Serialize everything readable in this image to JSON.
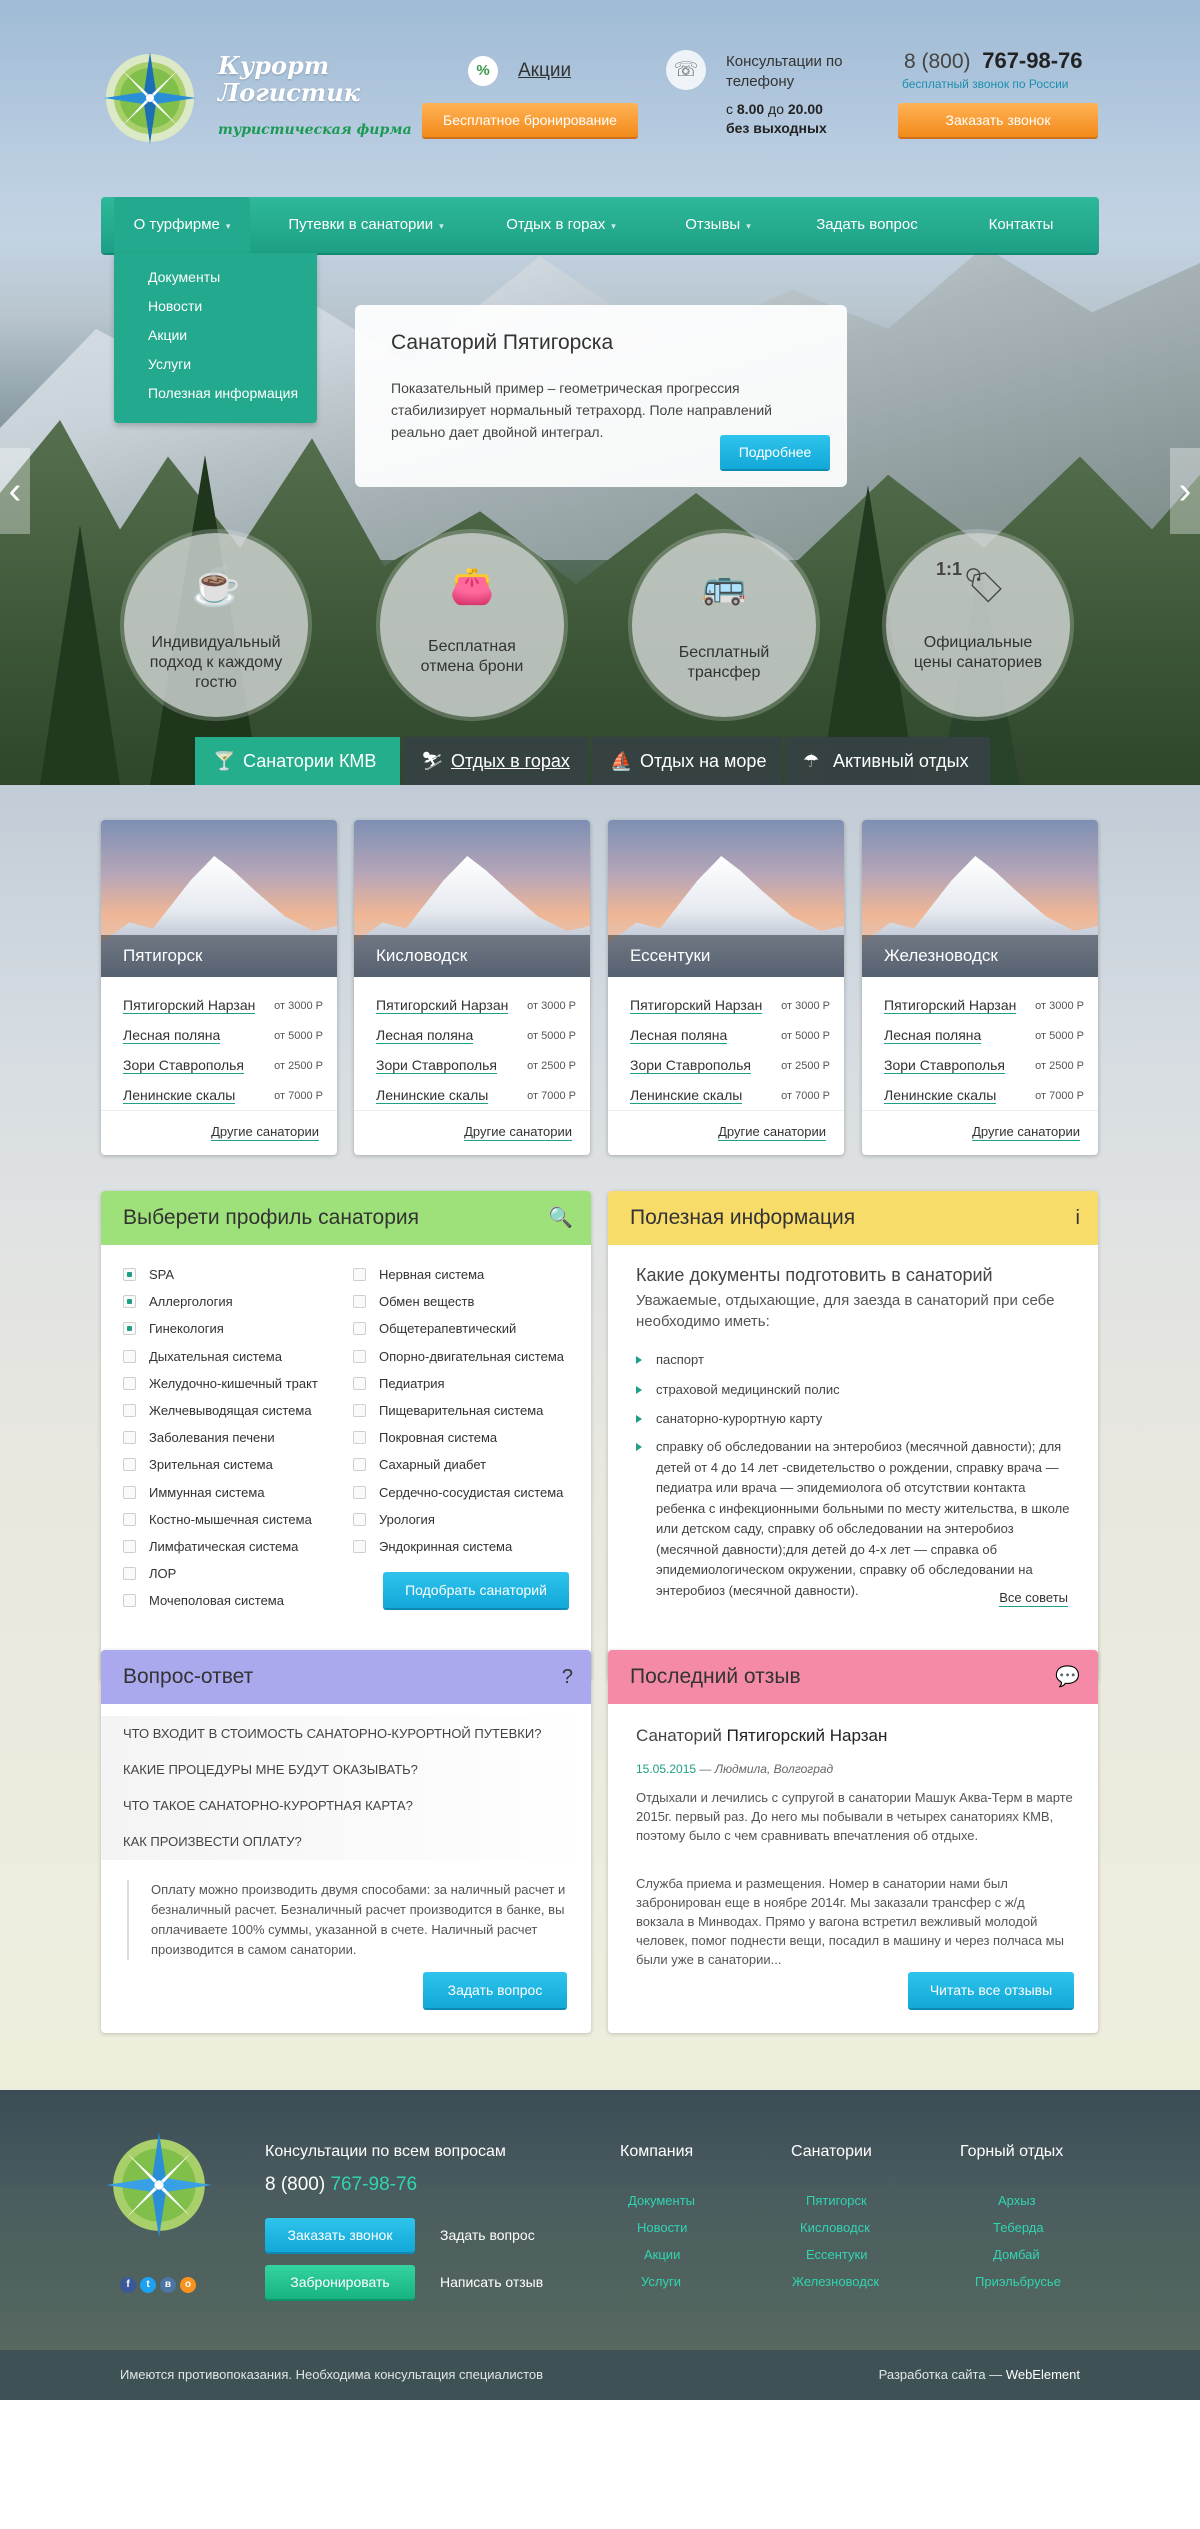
{
  "header": {
    "brand_line1": "Курорт",
    "brand_line2": "Логистик",
    "brand_tagline": "туристическая фирма",
    "promo_link": "Акции",
    "promo_icon": "percent-icon",
    "free_booking_btn": "Бесплатное бронирование",
    "consult_text": "Консультации по телефону",
    "hours_prefix": "с",
    "hours_from": "8.00",
    "hours_mid": "до",
    "hours_to": "20.00",
    "hours_days": "без выходных",
    "phone_code": "8 (800)",
    "phone_number": "767-98-76",
    "free_call": "бесплатный звонок по России",
    "callback_btn": "Заказать звонок"
  },
  "nav": {
    "items": [
      {
        "label": "О турфирме"
      },
      {
        "label": "Путевки в санатории"
      },
      {
        "label": "Отдых в горах"
      },
      {
        "label": "Отзывы"
      },
      {
        "label": "Задать вопрос"
      },
      {
        "label": "Контакты"
      }
    ],
    "dropdown": [
      "Документы",
      "Новости",
      "Акции",
      "Услуги",
      "Полезная информация"
    ]
  },
  "slide": {
    "title": "Санаторий Пятигорска",
    "text": "Показательный пример – геометрическая прогрессия стабилизирует нормальный тетрахорд. Поле направлений реально дает двойной интеграл.",
    "button": "Подробнее",
    "prev": "‹",
    "next": "›"
  },
  "features": [
    {
      "text": "Индивидуальный подход к каждому гостю",
      "icon": "cup-icon"
    },
    {
      "text": "Бесплатная отмена брони",
      "icon": "wallet-icon"
    },
    {
      "text": "Бесплатный трансфер",
      "icon": "bus-icon"
    },
    {
      "text": "Официальные цены санаториев",
      "icon": "price-tag-icon",
      "badge": "1:1"
    }
  ],
  "tabs": [
    {
      "label": "Санатории КМВ",
      "icon": "cocktail-icon"
    },
    {
      "label": "Отдых в горах",
      "icon": "ski-icon"
    },
    {
      "label": "Отдых на море",
      "icon": "ship-icon"
    },
    {
      "label": "Активный отдых",
      "icon": "parachute-icon"
    }
  ],
  "cities": [
    {
      "name": "Пятигорск",
      "more": "Другие санатории",
      "rows": [
        {
          "n": "Пятигорский Нарзан",
          "p": "от 3000 Р"
        },
        {
          "n": "Лесная поляна",
          "p": "от 5000 Р"
        },
        {
          "n": "Зори Ставрополья",
          "p": "от 2500 Р"
        },
        {
          "n": "Ленинские скалы",
          "p": "от 7000 Р"
        }
      ]
    },
    {
      "name": "Кисловодск",
      "more": "Другие санатории",
      "rows": [
        {
          "n": "Пятигорский Нарзан",
          "p": "от 3000 Р"
        },
        {
          "n": "Лесная поляна",
          "p": "от 5000 Р"
        },
        {
          "n": "Зори Ставрополья",
          "p": "от 2500 Р"
        },
        {
          "n": "Ленинские скалы",
          "p": "от 7000 Р"
        }
      ]
    },
    {
      "name": "Ессентуки",
      "more": "Другие санатории",
      "rows": [
        {
          "n": "Пятигорский Нарзан",
          "p": "от 3000 Р"
        },
        {
          "n": "Лесная поляна",
          "p": "от 5000 Р"
        },
        {
          "n": "Зори Ставрополья",
          "p": "от 2500 Р"
        },
        {
          "n": "Ленинские скалы",
          "p": "от 7000 Р"
        }
      ]
    },
    {
      "name": "Железноводск",
      "more": "Другие санатории",
      "rows": [
        {
          "n": "Пятигорский Нарзан",
          "p": "от 3000 Р"
        },
        {
          "n": "Лесная поляна",
          "p": "от 5000 Р"
        },
        {
          "n": "Зори Ставрополья",
          "p": "от 2500 Р"
        },
        {
          "n": "Ленинские скалы",
          "p": "от 7000 Р"
        }
      ]
    }
  ],
  "profile": {
    "title": "Выберети профиль санатория",
    "icon": "search-icon",
    "col1": [
      {
        "label": "SPA",
        "checked": true
      },
      {
        "label": "Аллергология",
        "checked": true
      },
      {
        "label": "Гинекология",
        "checked": true
      },
      {
        "label": "Дыхательная система",
        "checked": false
      },
      {
        "label": "Желудочно-кишечный тракт",
        "checked": false
      },
      {
        "label": "Желчевыводящая система",
        "checked": false
      },
      {
        "label": "Заболевания печени",
        "checked": false
      },
      {
        "label": "Зрительная система",
        "checked": false
      },
      {
        "label": "Иммунная система",
        "checked": false
      },
      {
        "label": "Костно-мышечная система",
        "checked": false
      },
      {
        "label": "Лимфатическая система",
        "checked": false
      },
      {
        "label": "ЛОР",
        "checked": false
      },
      {
        "label": "Мочеполовая система",
        "checked": false
      }
    ],
    "col2": [
      {
        "label": "Нервная система",
        "checked": false
      },
      {
        "label": "Обмен веществ",
        "checked": false
      },
      {
        "label": "Общетерапевтический",
        "checked": false
      },
      {
        "label": "Опорно-двигательная система",
        "checked": false
      },
      {
        "label": "Педиатрия",
        "checked": false
      },
      {
        "label": "Пищеварительная система",
        "checked": false
      },
      {
        "label": "Покровная система",
        "checked": false
      },
      {
        "label": "Сахарный диабет",
        "checked": false
      },
      {
        "label": "Сердечно-сосудистая система",
        "checked": false
      },
      {
        "label": "Урология",
        "checked": false
      },
      {
        "label": "Эндокринная система",
        "checked": false
      }
    ],
    "button": "Подобрать санаторий"
  },
  "info": {
    "title": "Полезная информация",
    "icon_glyph": "i",
    "q_title": "Какие документы подготовить в санаторий",
    "intro": "Уважаемые, отдыхающие, для заезда в санаторий при себе необходимо иметь:",
    "bullets": [
      "паспорт",
      "страховой медицинский полис",
      "санаторно-курортную карту",
      "справку об обследовании на энтеробиоз (месячной давности); для детей от 4 до 14 лет -свидетельство о рождении, справку врача — педиатра или врача — эпидемиолога об отсутствии контакта ребенка с инфекционными больными по месту жительства, в школе или детском саду, справку об обследовании на энтеробиоз (месячной давности);для детей до 4-х лет — справка об эпидемиологическом окружении, справку об обследовании на энтеробиоз (месячной давности)."
    ],
    "more": "Все советы"
  },
  "faq": {
    "title": "Вопрос-ответ",
    "icon_glyph": "?",
    "questions": [
      "ЧТО ВХОДИТ В СТОИМОСТЬ САНАТОРНО-КУРОРТНОЙ ПУТЕВКИ?",
      "КАКИЕ ПРОЦЕДУРЫ МНЕ БУДУТ ОКАЗЫВАТЬ?",
      "ЧТО ТАКОЕ САНАТОРНО-КУРОРТНАЯ КАРТА?",
      "КАК ПРОИЗВЕСТИ ОПЛАТУ?"
    ],
    "answer": "Оплату можно производить двумя способами: за наличный расчет и безналичный расчет. Безналичный расчет производится в банке, вы оплачиваете 100% суммы, указанной в счете. Наличный расчет производится в самом санатории.",
    "button": "Задать вопрос"
  },
  "review": {
    "title": "Последний отзыв",
    "icon": "chat-icon",
    "sanatorium_prefix": "Санаторий",
    "sanatorium_name": "Пятигорский Нарзан",
    "date": "15.05.2015",
    "author": "— Людмила, Волгоград",
    "p1": "Отдыхали и лечились с супругой в санатории Машук Аква-Терм в марте 2015г. первый раз. До него мы побывали в четырех санаториях КМВ, поэтому было с чем сравнивать впечатления об отдыхе.",
    "p2": "Служба приема и размещения. Номер в санатории нами был забронирован еще в ноябре 2014г. Мы заказали трансфер с ж/д вокзала в Минводах. Прямо у вагона встретил вежливый молодой человек, помог поднести вещи, посадил в машину и через полчаса мы были уже в санатории...",
    "button": "Читать все отзывы"
  },
  "footer": {
    "consult_title": "Консультации по всем вопросам",
    "phone_code": "8 (800)",
    "phone_number": "767-98-76",
    "callback_btn": "Заказать звонок",
    "ask_link": "Задать вопрос",
    "book_btn": "Забронировать",
    "review_link": "Написать отзыв",
    "social": [
      {
        "glyph": "f",
        "color": "#3b5998",
        "icon": "facebook-icon"
      },
      {
        "glyph": "t",
        "color": "#1da1f2",
        "icon": "twitter-icon"
      },
      {
        "glyph": "в",
        "color": "#4c75a3",
        "icon": "vk-icon"
      },
      {
        "glyph": "о",
        "color": "#f7931e",
        "icon": "odnoklassniki-icon"
      }
    ],
    "cols": [
      {
        "title": "Компания",
        "links": [
          "Документы",
          "Новости",
          "Акции",
          "Услуги"
        ]
      },
      {
        "title": "Санатории",
        "links": [
          "Пятигорск",
          "Кисловодск",
          "Ессентуки",
          "Железноводск"
        ]
      },
      {
        "title": "Горный отдых",
        "links": [
          "Архыз",
          "Теберда",
          "Домбай",
          "Приэльбрусье"
        ]
      }
    ],
    "disclaimer": "Имеются противопоказания. Необходима консультация специалистов",
    "dev_prefix": "Разработка сайта —",
    "dev_name": "WebElement"
  },
  "colors": {
    "accent": "#1da085",
    "orange": "#f28a1a",
    "blue": "#12a8d8",
    "profile": "#9ee07a",
    "info": "#f8dc6a",
    "faq": "#aaa9ee",
    "review": "#f48aa6"
  }
}
